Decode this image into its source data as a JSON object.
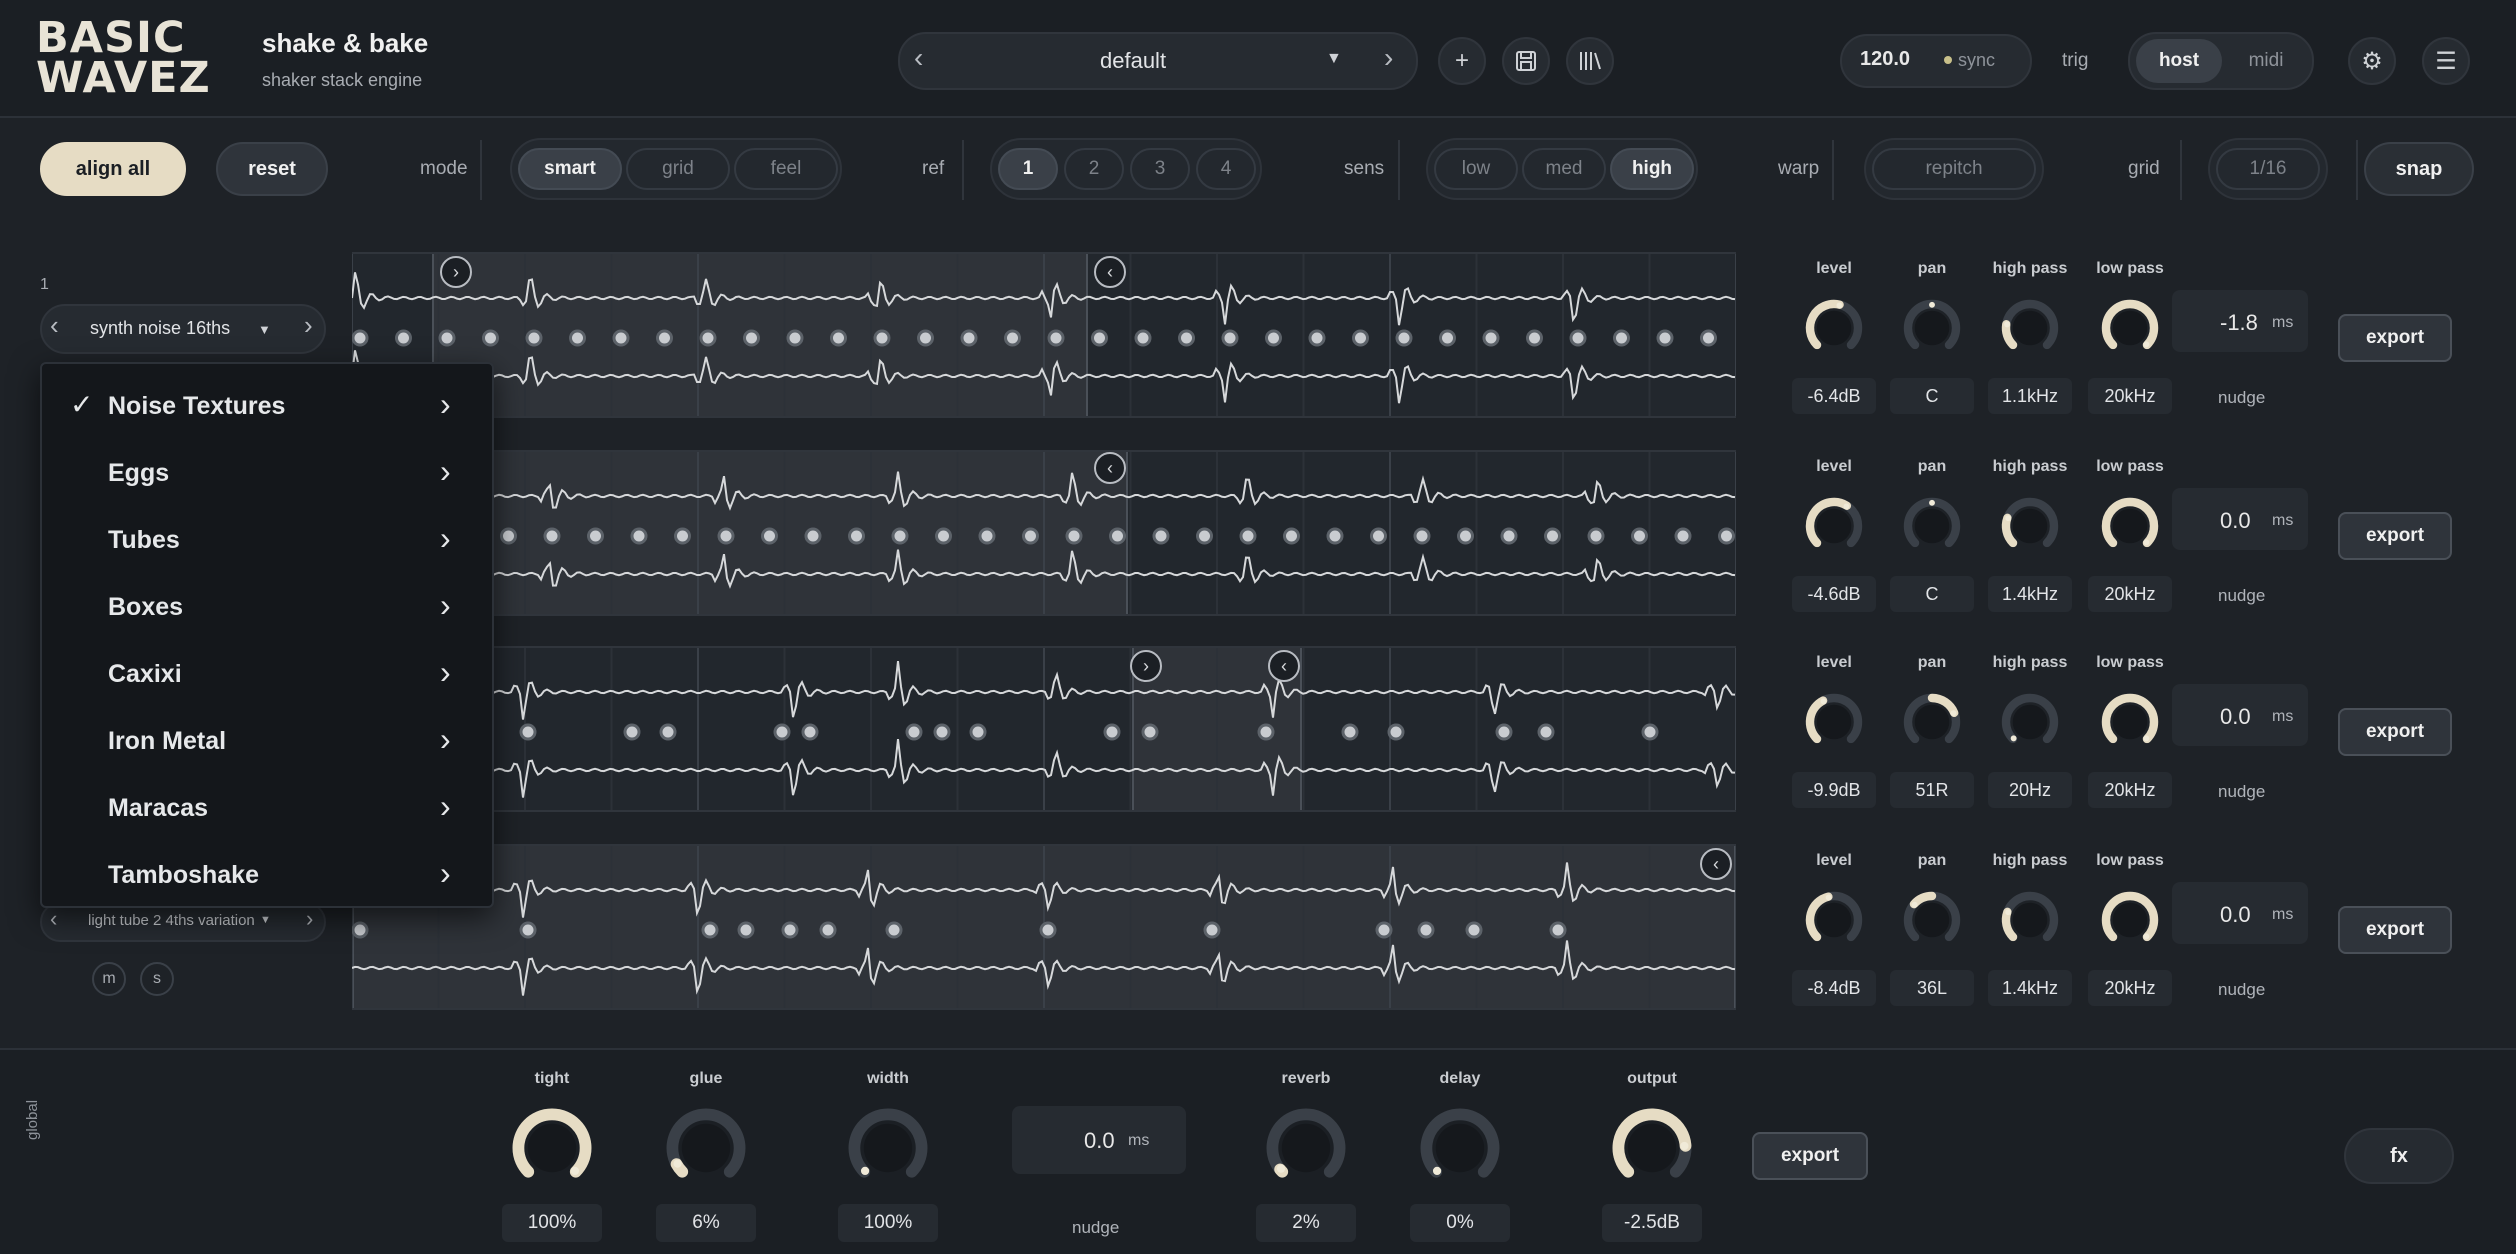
{
  "header": {
    "logo": "BASIC WAVEZ",
    "title": "shake & bake",
    "subtitle": "shaker stack engine",
    "preset": "default",
    "tempo": "120.0",
    "sync_label": "sync",
    "trig_label": "trig",
    "source_options": [
      "host",
      "midi"
    ],
    "source_selected": "host"
  },
  "toolbar": {
    "align_all": "align all",
    "reset": "reset",
    "mode_label": "mode",
    "mode_options": [
      "smart",
      "grid",
      "feel"
    ],
    "mode_selected": "smart",
    "ref_label": "ref",
    "ref_options": [
      "1",
      "2",
      "3",
      "4"
    ],
    "ref_selected": "1",
    "sens_label": "sens",
    "sens_options": [
      "low",
      "med",
      "high"
    ],
    "sens_selected": "high",
    "warp_label": "warp",
    "warp_value": "repitch",
    "grid_label": "grid",
    "grid_value": "1/16",
    "snap": "snap"
  },
  "track1": {
    "number": "1",
    "sample": "synth noise 16ths"
  },
  "track4": {
    "sample": "light tube 2 4ths variation",
    "mute": "m",
    "solo": "s"
  },
  "dropdown": {
    "items": [
      {
        "label": "Noise Textures",
        "checked": true
      },
      {
        "label": "Eggs",
        "checked": false
      },
      {
        "label": "Tubes",
        "checked": false
      },
      {
        "label": "Boxes",
        "checked": false
      },
      {
        "label": "Caxixi",
        "checked": false
      },
      {
        "label": "Iron Metal",
        "checked": false
      },
      {
        "label": "Maracas",
        "checked": false
      },
      {
        "label": "Tamboshake",
        "checked": false
      }
    ]
  },
  "control_labels": {
    "level": "level",
    "pan": "pan",
    "high_pass": "high pass",
    "low_pass": "low pass",
    "nudge": "nudge",
    "ms": "ms",
    "export": "export"
  },
  "tracks": [
    {
      "level": "-6.4dB",
      "pan": "C",
      "high_pass": "1.1kHz",
      "low_pass": "20kHz",
      "nudge": "-1.8",
      "level_pos": 0.55,
      "pan_pos": 0.5,
      "hp_pos": 0.2,
      "lp_pos": 1.0
    },
    {
      "level": "-4.6dB",
      "pan": "C",
      "high_pass": "1.4kHz",
      "low_pass": "20kHz",
      "nudge": "0.0",
      "level_pos": 0.62,
      "pan_pos": 0.5,
      "hp_pos": 0.24,
      "lp_pos": 1.0
    },
    {
      "level": "-9.9dB",
      "pan": "51R",
      "high_pass": "20Hz",
      "low_pass": "20kHz",
      "nudge": "0.0",
      "level_pos": 0.4,
      "pan_pos": 0.75,
      "hp_pos": 0.0,
      "lp_pos": 1.0
    },
    {
      "level": "-8.4dB",
      "pan": "36L",
      "high_pass": "1.4kHz",
      "low_pass": "20kHz",
      "nudge": "0.0",
      "level_pos": 0.45,
      "pan_pos": 0.32,
      "hp_pos": 0.24,
      "lp_pos": 1.0
    }
  ],
  "global": {
    "label": "global",
    "tight_label": "tight",
    "tight": "100%",
    "tight_pos": 1.0,
    "glue_label": "glue",
    "glue": "6%",
    "glue_pos": 0.06,
    "width_label": "width",
    "width": "100%",
    "width_pos": 0.0,
    "nudge": "0.0",
    "nudge_unit": "ms",
    "nudge_label": "nudge",
    "reverb_label": "reverb",
    "reverb": "2%",
    "reverb_pos": 0.02,
    "delay_label": "delay",
    "delay": "0%",
    "delay_pos": 0.0,
    "output_label": "output",
    "output": "-2.5dB",
    "output_pos": 0.82,
    "export": "export",
    "fx": "fx"
  },
  "colors": {
    "accent": "#e6dcc4",
    "background": "#1e2227",
    "panel": "#262b31",
    "knob_track": "#3a4048"
  }
}
